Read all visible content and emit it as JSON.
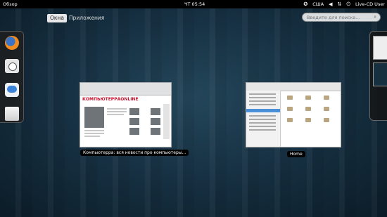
{
  "topbar": {
    "activities": "Обзор",
    "clock": "ЧТ 05:54",
    "keyboard_layout": "США",
    "user": "Live-CD User",
    "icons": [
      "accessibility-icon",
      "volume-icon",
      "network-icon",
      "power-icon"
    ]
  },
  "overview": {
    "tabs": {
      "windows": "Окна",
      "applications": "Приложения"
    },
    "search": {
      "placeholder": "Введите для поиска..."
    }
  },
  "dash": {
    "items": [
      "firefox-launcher",
      "clock-launcher",
      "empathy-launcher",
      "files-launcher"
    ]
  },
  "windows": [
    {
      "title": "Компьютерра: вся новости про компьютеры...",
      "site_logo_a": "КОМПЬЮТЕРРА",
      "site_logo_b": "ONLINE"
    },
    {
      "title": "Home"
    }
  ]
}
